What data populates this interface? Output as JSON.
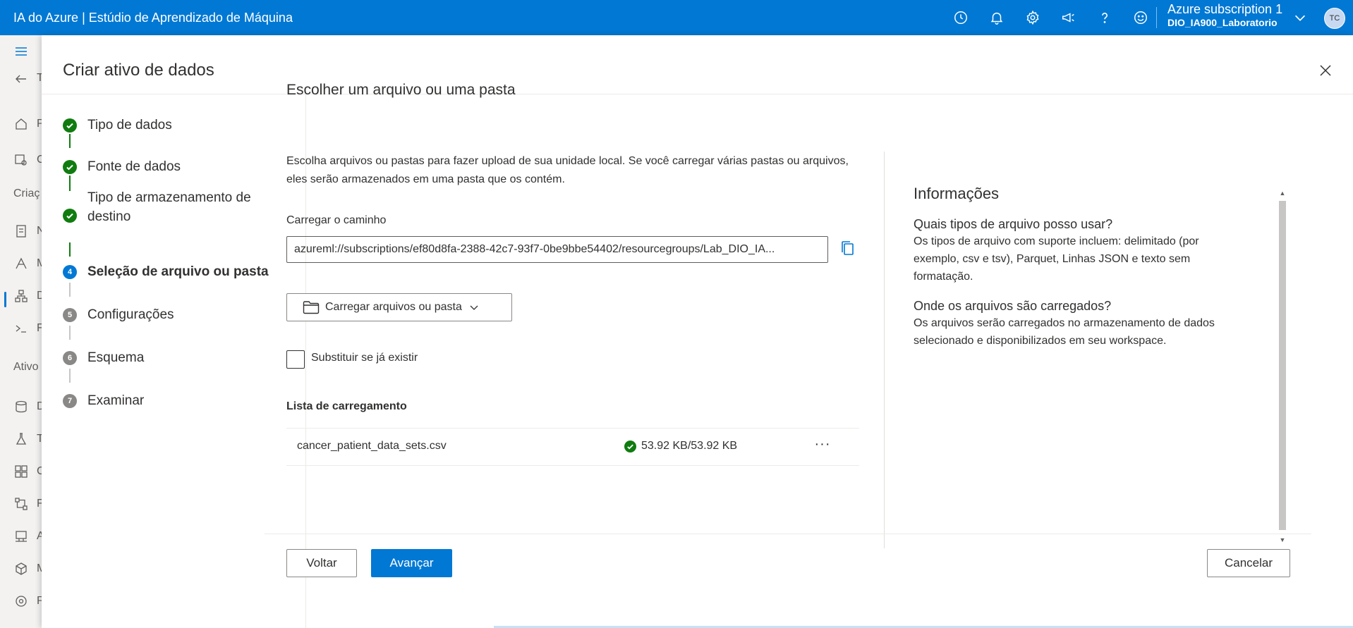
{
  "app": {
    "title": "IA do Azure | Estúdio de Aprendizado de Máquina"
  },
  "topbar": {
    "icons": [
      "history-icon",
      "bell-icon",
      "gear-icon",
      "megaphone-icon",
      "help-icon",
      "smiley-icon"
    ],
    "subscription_name": "Azure subscription 1",
    "workspace_name": "DIO_IA900_Laboratorio",
    "avatar_initials": "TC"
  },
  "leftnav": {
    "items_top": [
      {
        "icon": "home-icon",
        "letter": "P"
      },
      {
        "icon": "gallery-icon",
        "letter": "C"
      }
    ],
    "section_create": "Criaç",
    "items_create": [
      {
        "icon": "notebook-icon",
        "letter": "N"
      },
      {
        "icon": "automl-icon",
        "letter": "M"
      },
      {
        "icon": "designer-icon",
        "letter": "D"
      },
      {
        "icon": "prompt-icon",
        "letter": "F"
      }
    ],
    "section_assets": "Ativo",
    "items_assets": [
      {
        "icon": "data-icon",
        "letter": "D"
      },
      {
        "icon": "flask-icon",
        "letter": "T"
      },
      {
        "icon": "components-icon",
        "letter": "C"
      },
      {
        "icon": "pipeline-icon",
        "letter": "F"
      },
      {
        "icon": "environment-icon",
        "letter": "A"
      },
      {
        "icon": "model-icon",
        "letter": "M"
      },
      {
        "icon": "endpoint-icon",
        "letter": "P"
      }
    ],
    "back_letter": "T"
  },
  "panel": {
    "title": "Criar ativo de dados",
    "steps": [
      {
        "label": "Tipo de dados",
        "state": "done",
        "num": "1"
      },
      {
        "label": "Fonte de dados",
        "state": "done",
        "num": "2"
      },
      {
        "label": "Tipo de armazenamento de destino",
        "label_line1": "Tipo de armazenamento de",
        "label_line2": "destino",
        "state": "done",
        "num": "3"
      },
      {
        "label": "Seleção de arquivo ou pasta",
        "state": "current",
        "num": "4"
      },
      {
        "label": "Configurações",
        "state": "todo",
        "num": "5"
      },
      {
        "label": "Esquema",
        "state": "todo",
        "num": "6"
      },
      {
        "label": "Examinar",
        "state": "todo",
        "num": "7"
      }
    ]
  },
  "main": {
    "title": "Escolher um arquivo ou uma pasta",
    "description": "Escolha arquivos ou pastas para fazer upload de sua unidade local. Se você carregar várias pastas ou arquivos, eles serão armazenados em uma pasta que os contém.",
    "path_label": "Carregar o caminho",
    "path_value": "azureml://subscriptions/ef80d8fa-2388-42c7-93f7-0be9bbe54402/resourcegroups/Lab_DIO_IA...",
    "upload_button": "Carregar arquivos ou pasta",
    "overwrite_label": "Substituir se já existir",
    "overwrite_checked": false,
    "upload_list_title": "Lista de carregamento",
    "upload_list": [
      {
        "file": "cancer_patient_data_sets.csv",
        "status": "53.92 KB/53.92 KB",
        "more": "···"
      }
    ]
  },
  "info": {
    "title": "Informações",
    "q1": "Quais tipos de arquivo posso usar?",
    "a1": "Os tipos de arquivo com suporte incluem: delimitado (por exemplo, csv e tsv), Parquet, Linhas JSON e texto sem formatação.",
    "q2": "Onde os arquivos são carregados?",
    "a2": "Os arquivos serão carregados no armazenamento de dados selecionado e disponibilizados em seu workspace."
  },
  "footer": {
    "back": "Voltar",
    "next": "Avançar",
    "cancel": "Cancelar"
  },
  "colors": {
    "brand": "#0078d4",
    "success": "#107c10",
    "pending": "#8a8886"
  }
}
